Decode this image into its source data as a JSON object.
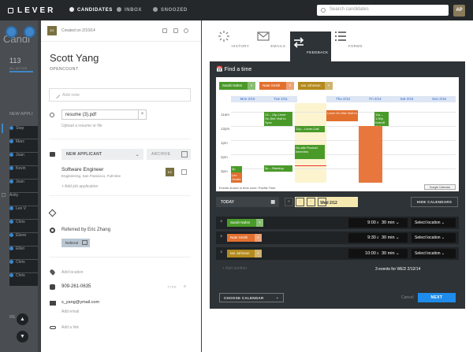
{
  "topbar": {
    "logo": "LEVER",
    "nav": [
      {
        "label": "CANDIDATES",
        "icon": "people-icon"
      },
      {
        "label": "INBOX",
        "icon": "inbox-icon"
      },
      {
        "label": "SNOOZED",
        "icon": "clock-icon"
      }
    ],
    "search_placeholder": "Search candidates",
    "avatar": "AP"
  },
  "background_list": {
    "title": "Candi",
    "count": "113",
    "count_label": "ALL ACTIVE",
    "section": "NEW APPLI",
    "rows": [
      "Step",
      "Marc",
      "Joan",
      "Kevin",
      "Jean",
      "Anity",
      "Leo V",
      "Chris",
      "Ebere",
      "Elliot",
      "Chris",
      "Chris"
    ],
    "section2": "RE"
  },
  "candidate": {
    "created": "Created on 2/10/14",
    "owner_initials": "EZ",
    "name": "Scott Yang",
    "company": "OPENCOUNT",
    "note_placeholder": "Add note",
    "resume_file": "resume (3).pdf",
    "upload_hint": "Upload a resume or file",
    "stage": "NEW APPLICANT",
    "archive": "ARCHIVE",
    "job_title": "Software Engineer",
    "job_sub": "Engineering, San Francisco, Full-time",
    "add_job": "+ Add job application",
    "referred_by": "Referred by Eric Zhang",
    "referral_button": "Referral",
    "add_location": "Add location",
    "phone": "909-261-0635",
    "phone_type": "TYPE",
    "email": "s_yang@ymail.com",
    "add_email": "Add email",
    "add_link": "Add a link"
  },
  "tabs": [
    {
      "label": "HISTORY",
      "icon": "history-icon"
    },
    {
      "label": "EMAILS",
      "icon": "envelope-icon"
    },
    {
      "label": "FEEDBACK",
      "icon": "arrows-icon"
    },
    {
      "label": "FORMS",
      "icon": "list-icon"
    }
  ],
  "scheduler": {
    "title": "Find a time",
    "people": [
      {
        "name": "Sarah Nahm",
        "color": "#4a9a2a"
      },
      {
        "name": "Nate Smith",
        "color": "#e2702f"
      },
      {
        "name": "Ian Johnson",
        "color": "#b48a1e"
      }
    ],
    "days": [
      "Mon 2/10",
      "Tue 2/11",
      "Wed 2/12",
      "Thu 2/13",
      "Fri 2/14",
      "Sat 2/15",
      "Sun 2/16"
    ],
    "times": [
      "11am",
      "12pm",
      "1pm",
      "2pm",
      "3pm"
    ],
    "events": [
      {
        "text": "13 – 13p Lever On-Site Visit to Sync",
        "color": "#4a9a2a"
      },
      {
        "text": "12p – Lever-Call",
        "color": "#4a9a2a"
      },
      {
        "text": "Lever On-Site Visit to",
        "color": "#e2702f"
      },
      {
        "text": "11a – 1:30p Kickoff Call",
        "color": "#4a9a2a"
      },
      {
        "text": "3p – Standup",
        "color": "#4a9a2a"
      },
      {
        "text": "3p",
        "color": "#4a9a2a"
      },
      {
        "text": "Lev Onsite",
        "color": "#e2702f"
      },
      {
        "text": "On-site Product Interview",
        "color": "#4a9a2a"
      }
    ],
    "timezone": "Events shown in time zone: Pacific Time",
    "gcal_badge": "Google Calendar",
    "today": "TODAY",
    "hide": "HIDE CALENDARS",
    "rows": [
      {
        "person": "Sarah Nahm",
        "color": "#4a9a2a",
        "time": "9:00 am",
        "duration": "30 min",
        "location": "Select location"
      },
      {
        "person": "Nate Smith",
        "color": "#e2702f",
        "time": "9:30 am",
        "duration": "30 min",
        "location": "Select location"
      },
      {
        "person": "Ian Johnson",
        "color": "#b48a1e",
        "time": "10:00 am",
        "duration": "30 min",
        "location": "Select location"
      }
    ],
    "add_another": "+ Add another",
    "events_summary": "3 events for WED 2/12/14",
    "choose_calendar": "CHOOSE CALENDAR",
    "cancel": "Cancel",
    "next": "NEXT"
  }
}
